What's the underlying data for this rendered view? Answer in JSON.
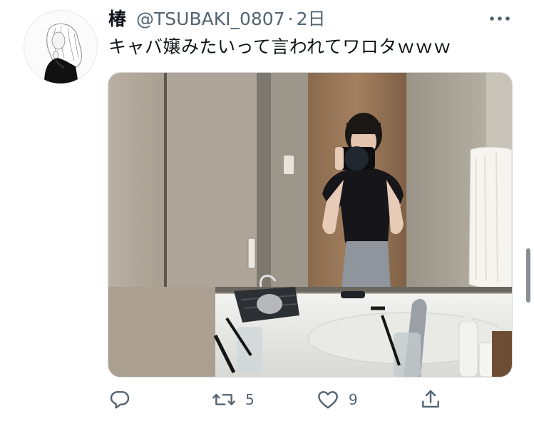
{
  "tweet": {
    "display_name": "椿",
    "handle": "@TSUBAKI_0807",
    "separator": "·",
    "time": "2日",
    "text": "キャバ嬢みたいって言われてワロタｗｗｗ",
    "avatar_icon": "illustrated-woman-avatar-icon",
    "more_icon": "more-dots-icon",
    "media_description_icon": "mirror-selfie-photo"
  },
  "actions": {
    "reply": {
      "icon": "reply-bubble-icon",
      "count": ""
    },
    "retweet": {
      "icon": "retweet-arrows-icon",
      "count": "5"
    },
    "like": {
      "icon": "heart-outline-icon",
      "count": "9"
    },
    "share": {
      "icon": "share-upload-icon",
      "count": ""
    }
  },
  "colors": {
    "text_primary": "#0f1419",
    "text_secondary": "#536471",
    "icon_gray": "#536471"
  }
}
